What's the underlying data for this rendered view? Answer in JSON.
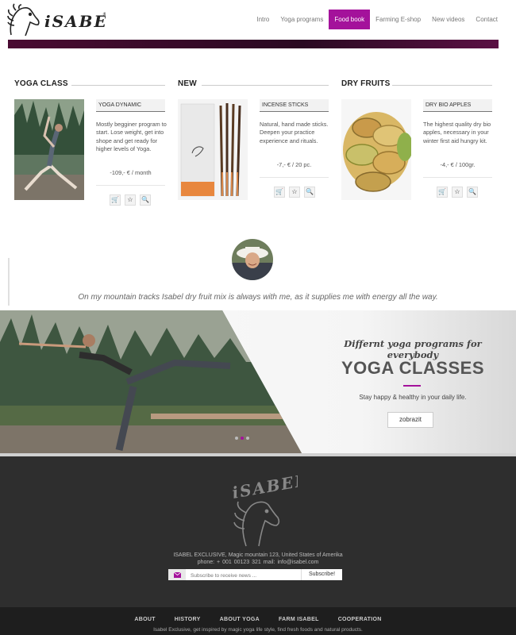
{
  "brand": {
    "name": "iSABEL"
  },
  "nav": {
    "items": [
      {
        "label": "Intro"
      },
      {
        "label": "Yoga programs"
      },
      {
        "label": "Food book"
      },
      {
        "label": "Farming E-shop"
      },
      {
        "label": "New videos"
      },
      {
        "label": "Contact"
      }
    ],
    "active": "Food book"
  },
  "products": [
    {
      "section": "YOGA CLASS",
      "name": "YOGA DYNAMIC",
      "desc": "Mostly begginer program to start. Lose weight, get into shope and get ready for higher levels of Yoga.",
      "price": "-109,- € / month"
    },
    {
      "section": "NEW",
      "name": "INCENSE STICKS",
      "desc": "Natural, hand made sticks. Deepen your practice experience and rituals.",
      "price": "-7,- € / 20 pc."
    },
    {
      "section": "DRY FRUITS",
      "name": "DRY BIO APPLES",
      "desc": "The highest quality dry bio apples, necessary in your winter first aid hungry kit.",
      "price": "-4,- € / 100gr."
    }
  ],
  "testimonial": {
    "quote": "On my mountain tracks Isabel dry fruit mix is always with me, as it supplies me with energy all the way."
  },
  "banner": {
    "subtitle": "Differnt yoga programs for everybody",
    "title": "YOGA CLASSES",
    "text": "Stay happy & healthy in your daily life.",
    "button": "zobrazit"
  },
  "footer": {
    "address": "ISABEL EXCLUSIVE, Magic mountain 123, United States of Amerika",
    "contact": "phone: + 001 00123 321        mail: info@isabel.com",
    "newsletter_placeholder": "Subscribe to receive news ...",
    "newsletter_button": "Subscribe!",
    "links": [
      {
        "label": "ABOUT"
      },
      {
        "label": "HISTORY"
      },
      {
        "label": "ABOUT YOGA"
      },
      {
        "label": "FARM ISABEL"
      },
      {
        "label": "COOPERATION"
      }
    ],
    "tagline": "Isabel Exclusive,   get inspired by magic yoga life style, find fresh foods and natural products."
  },
  "colors": {
    "accent": "#a4129b",
    "footer_bg": "#2e2e2e",
    "bottom_bar": "#1e1e1e"
  }
}
